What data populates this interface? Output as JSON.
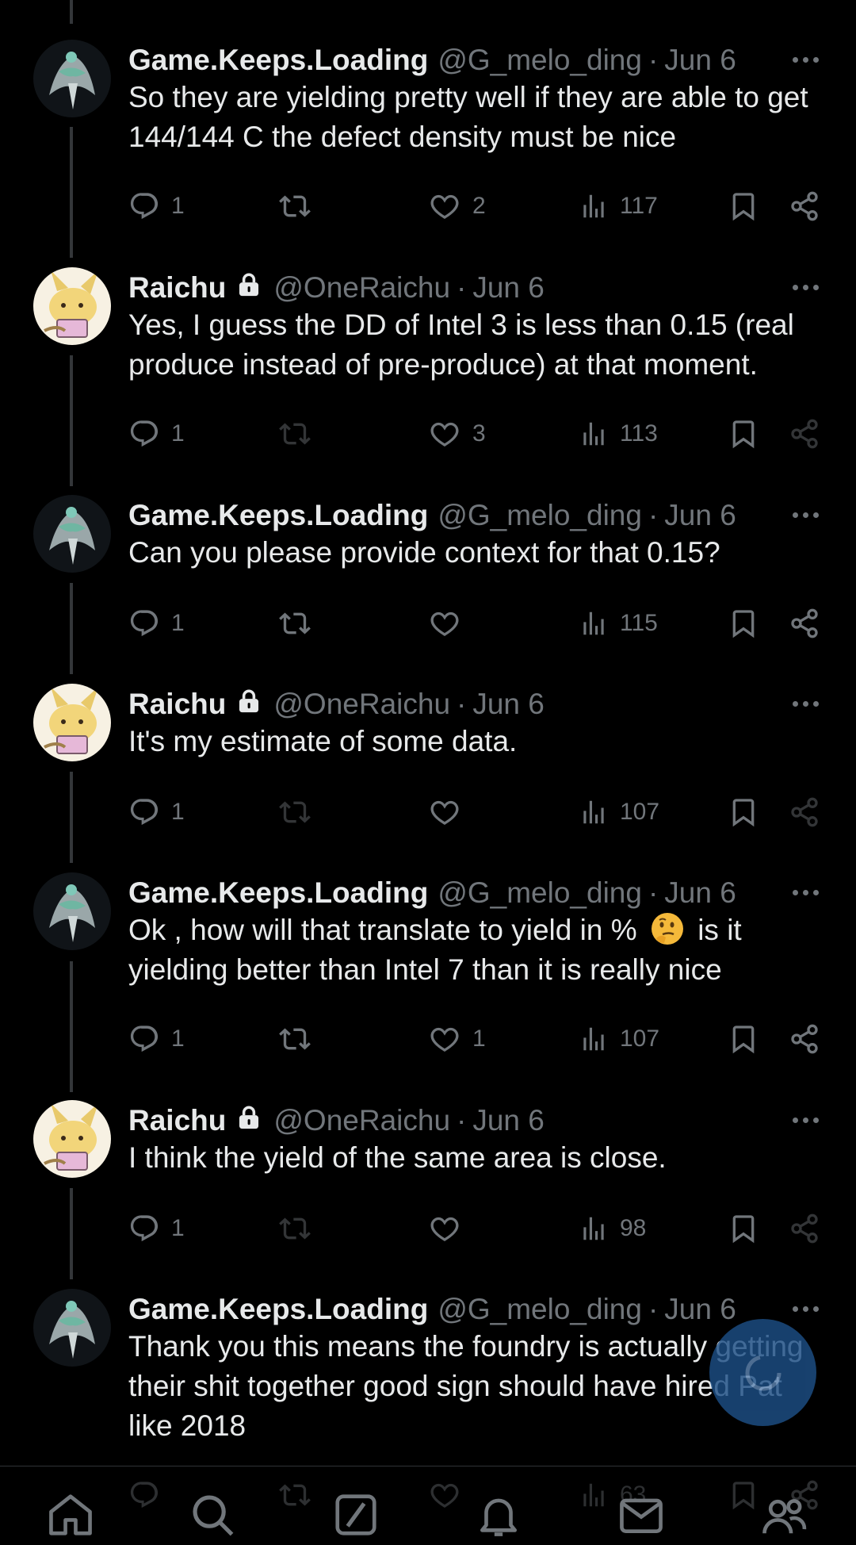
{
  "colors": {
    "background": "#000000",
    "text": "#e7e9ea",
    "secondary": "#71767b",
    "thread_line": "#333639",
    "fab": "#1d4f86"
  },
  "tweets": [
    {
      "name": "Game.Keeps.Loading",
      "locked": false,
      "handle": "@G_melo_ding",
      "date": "Jun 6",
      "avatar": "gkl-avatar",
      "lines": [
        "So they are yielding pretty well if they are able to get",
        "144/144 C the defect density must be nice"
      ],
      "replies": "1",
      "retweets": "",
      "likes": "2",
      "views": "117"
    },
    {
      "name": "Raichu",
      "locked": true,
      "handle": "@OneRaichu",
      "date": "Jun 6",
      "avatar": "raichu-avatar",
      "lines": [
        "Yes, I guess the DD of Intel 3 is less than 0.15 (real",
        "produce instead of pre-produce) at that moment."
      ],
      "replies": "1",
      "retweets": "",
      "likes": "3",
      "views": "113"
    },
    {
      "name": "Game.Keeps.Loading",
      "locked": false,
      "handle": "@G_melo_ding",
      "date": "Jun 6",
      "avatar": "gkl-avatar",
      "lines": [
        "Can you please provide context for that 0.15?"
      ],
      "replies": "1",
      "retweets": "",
      "likes": "",
      "views": "115"
    },
    {
      "name": "Raichu",
      "locked": true,
      "handle": "@OneRaichu",
      "date": "Jun 6",
      "avatar": "raichu-avatar",
      "lines": [
        "It's my estimate of some data."
      ],
      "replies": "1",
      "retweets": "",
      "likes": "",
      "views": "107"
    },
    {
      "name": "Game.Keeps.Loading",
      "locked": false,
      "handle": "@G_melo_ding",
      "date": "Jun 6",
      "avatar": "gkl-avatar",
      "line_a": "Ok , how will that translate to yield in %",
      "emoji": "thinking-face",
      "line_b": "is it",
      "line2": "yielding better than Intel 7 than it is really nice",
      "replies": "1",
      "retweets": "",
      "likes": "1",
      "views": "107"
    },
    {
      "name": "Raichu",
      "locked": true,
      "handle": "@OneRaichu",
      "date": "Jun 6",
      "avatar": "raichu-avatar",
      "lines": [
        "I think the yield of the same area is close."
      ],
      "replies": "1",
      "retweets": "",
      "likes": "",
      "views": "98"
    },
    {
      "name": "Game.Keeps.Loading",
      "locked": false,
      "handle": "@G_melo_ding",
      "date": "Jun 6",
      "avatar": "gkl-avatar",
      "lines": [
        "Thank you this means the foundry is actually getting",
        "their shit together good sign should have hired Pat",
        "like 2018"
      ],
      "replies": "",
      "retweets": "",
      "likes": "",
      "views": "63"
    }
  ],
  "bottom_nav": [
    "home-icon",
    "search-icon",
    "grok-icon",
    "notifications-icon",
    "messages-icon",
    "communities-icon"
  ]
}
